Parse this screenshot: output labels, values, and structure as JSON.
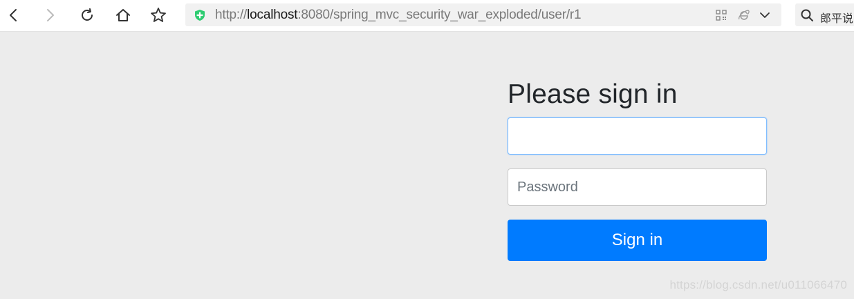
{
  "browser": {
    "url_prefix": "http://",
    "url_host": "localhost",
    "url_rest": ":8080/spring_mvc_security_war_exploded/user/r1",
    "search_text": "郎平说"
  },
  "form": {
    "heading": "Please sign in",
    "username_value": "",
    "password_placeholder": "Password",
    "submit_label": "Sign in"
  },
  "watermark": "https://blog.csdn.net/u011066470",
  "colors": {
    "primary": "#007bff",
    "focus_border": "#80bdff",
    "page_bg": "#ececec",
    "shield": "#2ecc71"
  },
  "icons": [
    "back-icon",
    "forward-icon",
    "reload-icon",
    "home-icon",
    "star-icon",
    "shield-icon",
    "qr-code-icon",
    "ie-icon",
    "chevron-down-icon",
    "search-icon"
  ]
}
